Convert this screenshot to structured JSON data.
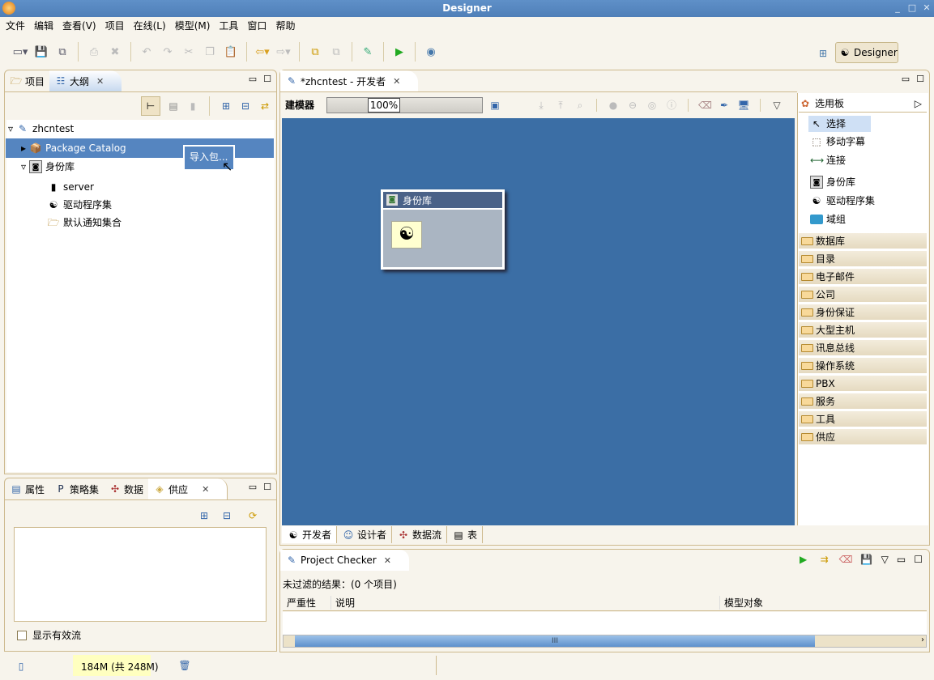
{
  "window": {
    "title": "Designer",
    "controls": [
      "_",
      "□",
      "✕"
    ]
  },
  "menu": [
    "文件",
    "编辑",
    "查看(V)",
    "项目",
    "在线(L)",
    "模型(M)",
    "工具",
    "窗口",
    "帮助"
  ],
  "perspective": {
    "label": "Designer"
  },
  "left_top": {
    "tabs": [
      {
        "label": "项目"
      },
      {
        "label": "大纲"
      }
    ],
    "tree": {
      "root": "zhcntest",
      "items": [
        {
          "label": "Package Catalog"
        },
        {
          "label": "身份库"
        },
        {
          "label": "server"
        },
        {
          "label": "驱动程序集"
        },
        {
          "label": "默认通知集合"
        }
      ]
    },
    "tooltip": "导入包..."
  },
  "left_bottom": {
    "tabs": [
      {
        "label": "属性"
      },
      {
        "label": "策略集"
      },
      {
        "label": "数据"
      },
      {
        "label": "供应"
      }
    ],
    "checkbox_label": "显示有效流",
    "checkbox_checked": false
  },
  "editor": {
    "tab": "*zhcntest - 开发者",
    "modeler_label": "建模器",
    "zoom": "100%",
    "node_title": "身份库",
    "bottom_tabs": [
      {
        "label": "开发者"
      },
      {
        "label": "设计者"
      },
      {
        "label": "数据流"
      },
      {
        "label": "表"
      }
    ]
  },
  "palette": {
    "title": "选用板",
    "tools": [
      {
        "label": "选择"
      },
      {
        "label": "移动字幕"
      },
      {
        "label": "连接"
      },
      {
        "label": "身份库"
      },
      {
        "label": "驱动程序集"
      },
      {
        "label": "域组"
      }
    ],
    "drawers": [
      "数据库",
      "目录",
      "电子邮件",
      "公司",
      "身份保证",
      "大型主机",
      "讯息总线",
      "操作系统",
      "PBX",
      "服务",
      "工具",
      "供应"
    ]
  },
  "checker": {
    "tab": "Project Checker",
    "summary": "未过滤的结果：(0 个项目)",
    "columns": [
      "严重性",
      "说明",
      "模型对象"
    ],
    "scroll_grip": "III"
  },
  "status": {
    "memory": "184M (共  248M)"
  },
  "colors": {
    "canvas": "#3b6ea5",
    "selection": "#5585c0"
  }
}
